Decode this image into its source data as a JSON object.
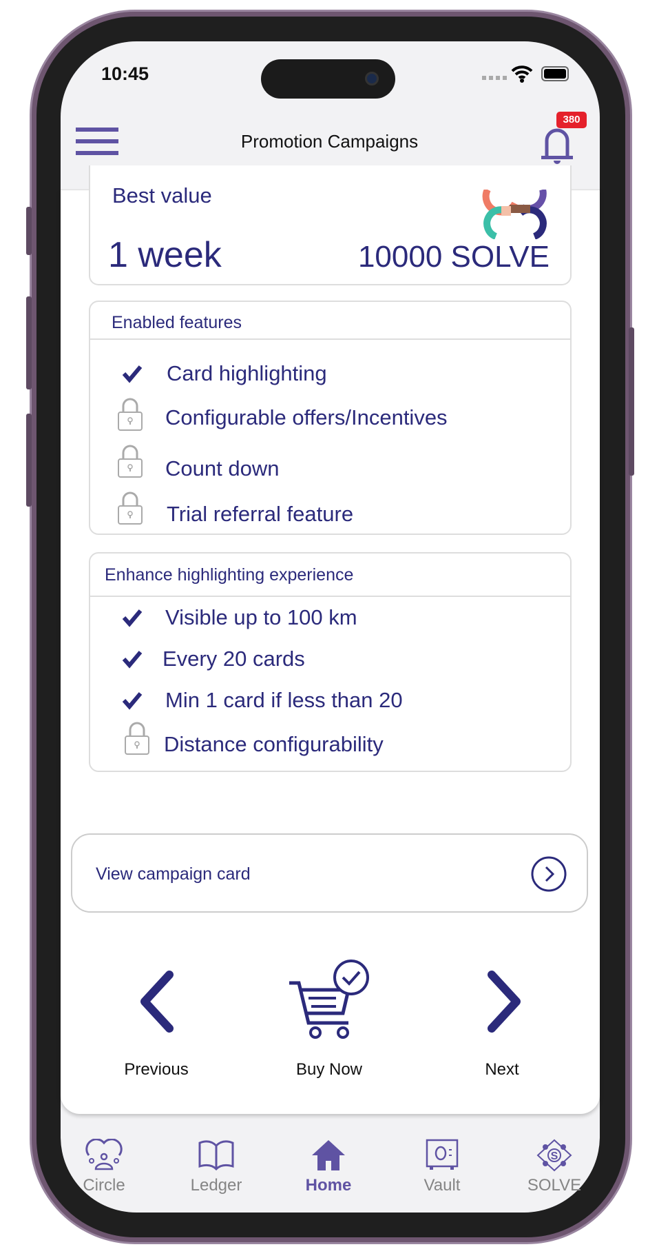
{
  "status_bar": {
    "time": "10:45"
  },
  "header": {
    "title": "Promotion Campaigns",
    "notification_count": "380"
  },
  "plan": {
    "label": "Best value",
    "duration": "1 week",
    "price": "10000 SOLVE"
  },
  "enabled_features": {
    "title": "Enabled features",
    "items": [
      {
        "label": "Card highlighting",
        "status": "enabled"
      },
      {
        "label": "Configurable offers/Incentives",
        "status": "locked"
      },
      {
        "label": "Count down",
        "status": "locked"
      },
      {
        "label": "Trial referral feature",
        "status": "locked"
      }
    ]
  },
  "enhance": {
    "title": "Enhance highlighting experience",
    "items": [
      {
        "label": "Visible up to 100 km",
        "status": "enabled"
      },
      {
        "label": "Every 20 cards",
        "status": "enabled"
      },
      {
        "label": "Min 1 card if less than 20",
        "status": "enabled"
      },
      {
        "label": "Distance configurability",
        "status": "locked"
      }
    ]
  },
  "view_card": {
    "label": "View campaign card"
  },
  "actions": {
    "previous": "Previous",
    "buy": "Buy Now",
    "next": "Next"
  },
  "bottom_nav": {
    "items": [
      {
        "label": "Circle"
      },
      {
        "label": "Ledger"
      },
      {
        "label": "Home",
        "active": true
      },
      {
        "label": "Vault"
      },
      {
        "label": "SOLVE"
      }
    ]
  },
  "colors": {
    "accent": "#5f53a3",
    "text": "#2b2a7b",
    "badge": "#e5212b"
  }
}
